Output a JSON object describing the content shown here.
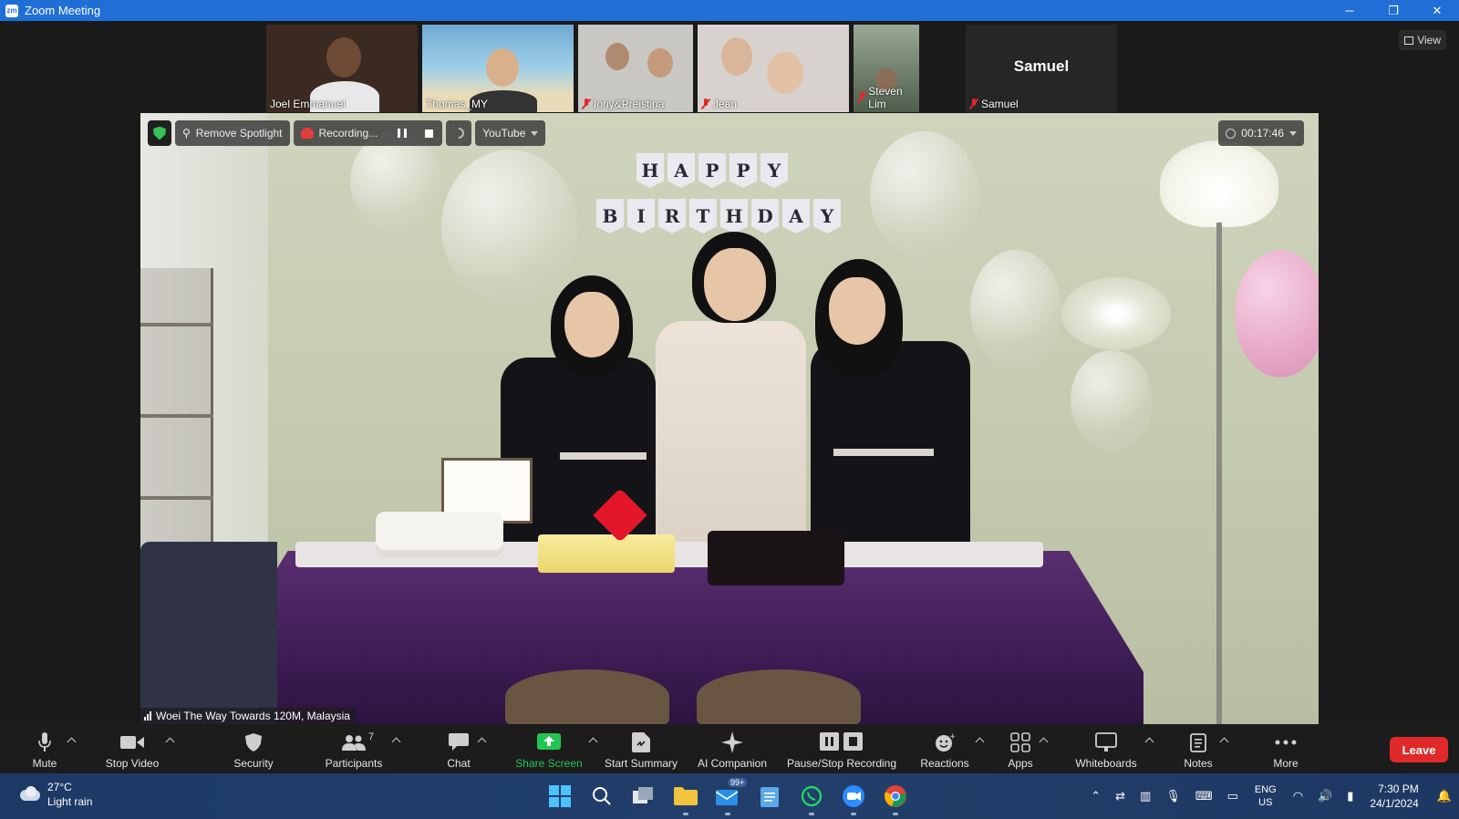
{
  "window": {
    "title": "Zoom Meeting",
    "app_icon": "zm",
    "controls": {
      "minimize": "─",
      "restore": "❐",
      "close": "✕"
    }
  },
  "view_button": {
    "label": "View"
  },
  "participants_strip": [
    {
      "name": "Joel Emmanuel",
      "muted": false,
      "bg": "#3a2a22"
    },
    {
      "name": "Thomas_MY",
      "muted": false,
      "bg": "#6fa9d2"
    },
    {
      "name": "Iony&Preistina",
      "muted": true,
      "bg": "#c9c7c2"
    },
    {
      "name": "Jean",
      "muted": true,
      "bg": "#d8d2cf"
    },
    {
      "name": "Steven Lim",
      "muted": true,
      "bg": "#6c7c66"
    },
    {
      "name": "Samuel",
      "muted": true,
      "bg": "#262626",
      "big_name": "Samuel"
    }
  ],
  "video_toolbar": {
    "remove_spotlight": "Remove Spotlight",
    "recording": "Recording...",
    "live_target": "YouTube",
    "timer": "00:17:46"
  },
  "banner": {
    "row1": [
      "H",
      "A",
      "P",
      "P",
      "Y"
    ],
    "row2": [
      "B",
      "I",
      "R",
      "T",
      "H",
      "D",
      "A",
      "Y"
    ]
  },
  "active_speaker": {
    "name": "Woei The Way Towards 120M, Malaysia"
  },
  "controls": {
    "mute": "Mute",
    "stop_video": "Stop Video",
    "security": "Security",
    "participants": "Participants",
    "participants_count": "7",
    "chat": "Chat",
    "share_screen": "Share Screen",
    "start_summary": "Start Summary",
    "ai_companion": "AI Companion",
    "pause_stop_recording": "Pause/Stop Recording",
    "reactions": "Reactions",
    "apps": "Apps",
    "whiteboards": "Whiteboards",
    "notes": "Notes",
    "more": "More",
    "leave": "Leave"
  },
  "taskbar": {
    "weather_temp": "27°C",
    "weather_desc": "Light rain",
    "mail_badge": "99+",
    "lang_top": "ENG",
    "lang_bottom": "US",
    "time": "7:30 PM",
    "date": "24/1/2024"
  },
  "colors": {
    "titlebar": "#1f6fd6",
    "leave": "#e02a2a",
    "share_screen": "#23c552",
    "muted_red": "#e02828"
  }
}
